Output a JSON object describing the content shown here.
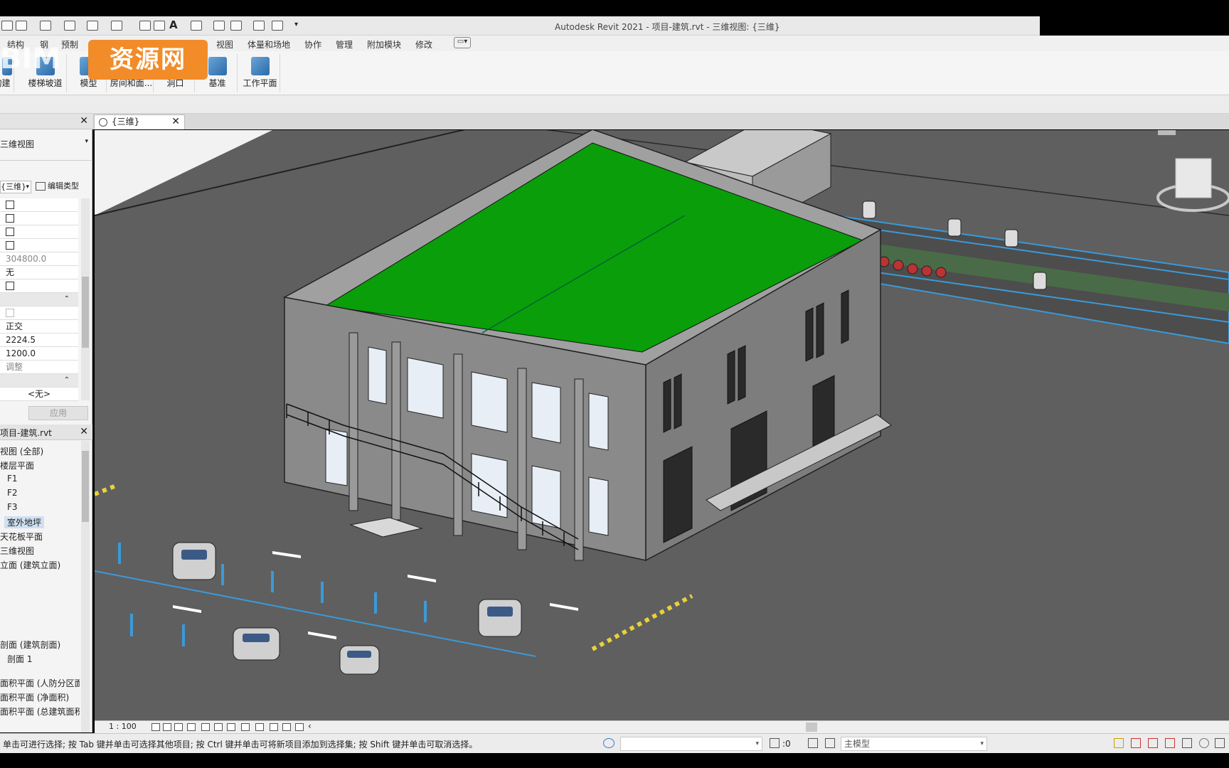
{
  "app": {
    "title": "Autodesk Revit 2021 - 项目-建筑.rvt - 三维视图: {三维}"
  },
  "ribbon_tabs": [
    "结构",
    "钢",
    "预制",
    "视图",
    "体量和场地",
    "协作",
    "管理",
    "附加模块",
    "修改"
  ],
  "ribbon_buttons": [
    "构建",
    "楼梯坡道",
    "模型",
    "房间和面...",
    "洞口",
    "基准",
    "工作平面"
  ],
  "watermark": {
    "text": "资源网",
    "left_text": "BIM"
  },
  "properties": {
    "type_name": "三维视图",
    "selector_value": "{三维}",
    "edit_type_label": "编辑类型",
    "values": [
      "304800.0",
      "无",
      "正交",
      "2224.5",
      "1200.0",
      "调整",
      "<无>"
    ],
    "apply_label": "应用"
  },
  "project_browser": {
    "title": "项目-建筑.rvt",
    "items": [
      "视图 (全部)",
      "楼层平面",
      "F1",
      "F2",
      "F3",
      "室外地坪",
      "天花板平面",
      "三维视图",
      "立面 (建筑立面)",
      "剖面 (建筑剖面)",
      "剖面 1",
      "面积平面 (人防分区面积)",
      "面积平面 (净面积)",
      "面积平面 (总建筑面积)"
    ],
    "selected": "室外地坪"
  },
  "view_tab": {
    "label": "{三维}"
  },
  "view_controls": {
    "scale": "1 : 100"
  },
  "status": {
    "message": "单击可进行选择; 按 Tab 键并单击可选择其他项目; 按 Ctrl 键并单击可将新项目添加到选择集; 按 Shift 键并单击可取消选择。",
    "coord": ":0",
    "model_select": "主模型"
  },
  "colors": {
    "roof_green": "#0a9e0a",
    "building_gray": "#8a8a8a",
    "ground_gray": "#5f5f5f",
    "parking_blue": "#3a9ad9",
    "accent_orange": "#f28c28"
  }
}
